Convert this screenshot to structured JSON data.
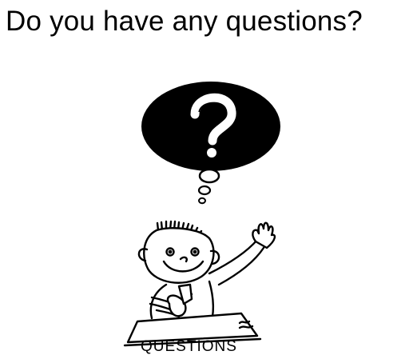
{
  "slide": {
    "title": "Do you have any questions?"
  },
  "illustration": {
    "icon": "question-mark-thought-bubble",
    "figure": "cartoon-child-raising-hand",
    "label": "QUESTIONS",
    "colors": {
      "ink": "#000000",
      "paper": "#ffffff"
    }
  }
}
